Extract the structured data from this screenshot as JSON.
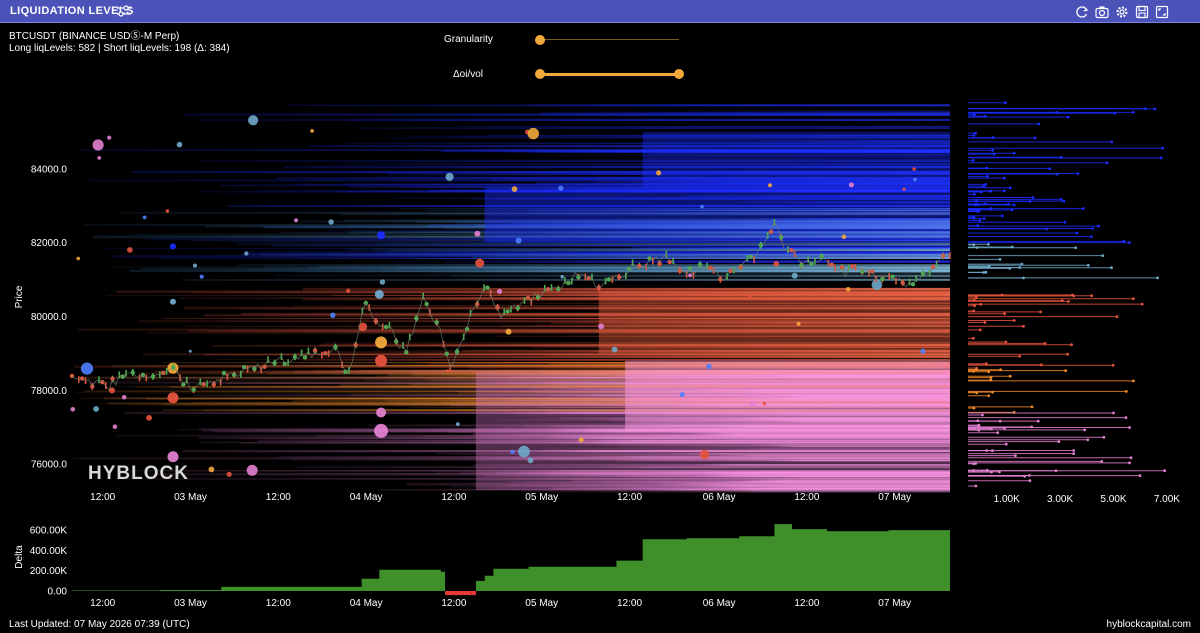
{
  "title_bar": {
    "title": "LIQUIDATION LEVELS",
    "icons": [
      "sliders-icon",
      "refresh-icon",
      "camera-icon",
      "settings-icon",
      "save-icon",
      "fullscreen-icon"
    ]
  },
  "info": {
    "symbol": "BTCUSDT (BINANCE USDⓈ-M Perp)",
    "levels": "Long liqLevels: 582 | Short liqLevels: 198 (Δ: 384)"
  },
  "controls": {
    "granularity_label": "Granularity",
    "granularity_value": 0.0,
    "oi_vol_label": "Δoi/vol",
    "oi_vol_range": [
      0.0,
      1.0
    ]
  },
  "watermark": "HYBLOCK",
  "colors": {
    "accent": "#f2a93b",
    "titlebar": "#4b52b8",
    "long_up": "#4caf50",
    "short_down": "#e5533d",
    "delta_fill": "#3f8f2a",
    "delta_negative": "#e53935"
  },
  "chart_data": [
    {
      "type": "scatter",
      "title": "",
      "ylabel": "Price",
      "yticks": [
        "84000.0",
        "82000.0",
        "80000.0",
        "78000.0",
        "76000.0"
      ],
      "ylim": [
        75300,
        86000
      ],
      "xticks": [
        "12:00",
        "03 May",
        "12:00",
        "04 May",
        "12:00",
        "05 May",
        "12:00",
        "06 May",
        "12:00",
        "07 May"
      ],
      "price_series": [
        [
          0,
          78300
        ],
        [
          0.02,
          78250
        ],
        [
          0.04,
          78100
        ],
        [
          0.06,
          78400
        ],
        [
          0.08,
          78450
        ],
        [
          0.1,
          78500
        ],
        [
          0.115,
          78600
        ],
        [
          0.125,
          78200
        ],
        [
          0.14,
          78100
        ],
        [
          0.16,
          78250
        ],
        [
          0.18,
          78400
        ],
        [
          0.2,
          78550
        ],
        [
          0.22,
          78700
        ],
        [
          0.24,
          78800
        ],
        [
          0.26,
          78900
        ],
        [
          0.28,
          79000
        ],
        [
          0.3,
          79200
        ],
        [
          0.315,
          78400
        ],
        [
          0.325,
          79400
        ],
        [
          0.335,
          80500
        ],
        [
          0.345,
          79800
        ],
        [
          0.36,
          79700
        ],
        [
          0.38,
          79000
        ],
        [
          0.4,
          80500
        ],
        [
          0.42,
          79600
        ],
        [
          0.43,
          78700
        ],
        [
          0.445,
          79300
        ],
        [
          0.455,
          80200
        ],
        [
          0.47,
          80800
        ],
        [
          0.49,
          80000
        ],
        [
          0.51,
          80300
        ],
        [
          0.53,
          80600
        ],
        [
          0.56,
          80900
        ],
        [
          0.58,
          81200
        ],
        [
          0.6,
          80800
        ],
        [
          0.62,
          81000
        ],
        [
          0.64,
          81400
        ],
        [
          0.66,
          81500
        ],
        [
          0.68,
          81600
        ],
        [
          0.7,
          81200
        ],
        [
          0.72,
          81300
        ],
        [
          0.74,
          81000
        ],
        [
          0.76,
          81400
        ],
        [
          0.78,
          81700
        ],
        [
          0.8,
          82500
        ],
        [
          0.81,
          81900
        ],
        [
          0.83,
          81500
        ],
        [
          0.86,
          81600
        ],
        [
          0.88,
          81200
        ],
        [
          0.9,
          81300
        ],
        [
          0.93,
          81000
        ],
        [
          0.96,
          80900
        ],
        [
          1.0,
          81700
        ]
      ],
      "liquidation_bands": [
        {
          "name": "short",
          "from": 81500,
          "to": 85800,
          "color": "#1a2cff"
        },
        {
          "name": "short-mid",
          "from": 81000,
          "to": 83000,
          "color": "#3b7fbf"
        },
        {
          "name": "long-red",
          "from": 78500,
          "to": 80800,
          "color": "#d9503a"
        },
        {
          "name": "long-orange",
          "from": 77400,
          "to": 78800,
          "color": "#f08a2a"
        },
        {
          "name": "long-pink",
          "from": 75300,
          "to": 78600,
          "color": "#e27fd0"
        }
      ]
    },
    {
      "type": "bar",
      "title": "",
      "xlabel": "",
      "ylabel": "",
      "xticks": [
        "1.00K",
        "3.00K",
        "5.00K",
        "7.00K"
      ],
      "xlim": [
        0,
        8500
      ]
    },
    {
      "type": "area",
      "title": "",
      "ylabel": "Delta",
      "yticks": [
        "600.00K",
        "400.00K",
        "200.00K",
        "0.00"
      ],
      "ylim": [
        0,
        700000
      ],
      "xticks": [
        "12:00",
        "03 May",
        "12:00",
        "04 May",
        "12:00",
        "05 May",
        "12:00",
        "06 May",
        "12:00",
        "07 May"
      ],
      "x": [
        0,
        0.1,
        0.17,
        0.33,
        0.35,
        0.42,
        0.425,
        0.455,
        0.46,
        0.47,
        0.48,
        0.52,
        0.62,
        0.65,
        0.7,
        0.76,
        0.8,
        0.82,
        0.86,
        0.93,
        1.0
      ],
      "values": [
        5000,
        10000,
        40000,
        120000,
        210000,
        190000,
        -40000,
        -40000,
        100000,
        150000,
        220000,
        240000,
        300000,
        510000,
        520000,
        540000,
        660000,
        610000,
        590000,
        600000,
        610000
      ]
    }
  ],
  "footer": {
    "last_updated": "Last Updated: 07 May 2026 07:39 (UTC)",
    "source": "hyblockcapital.com"
  }
}
